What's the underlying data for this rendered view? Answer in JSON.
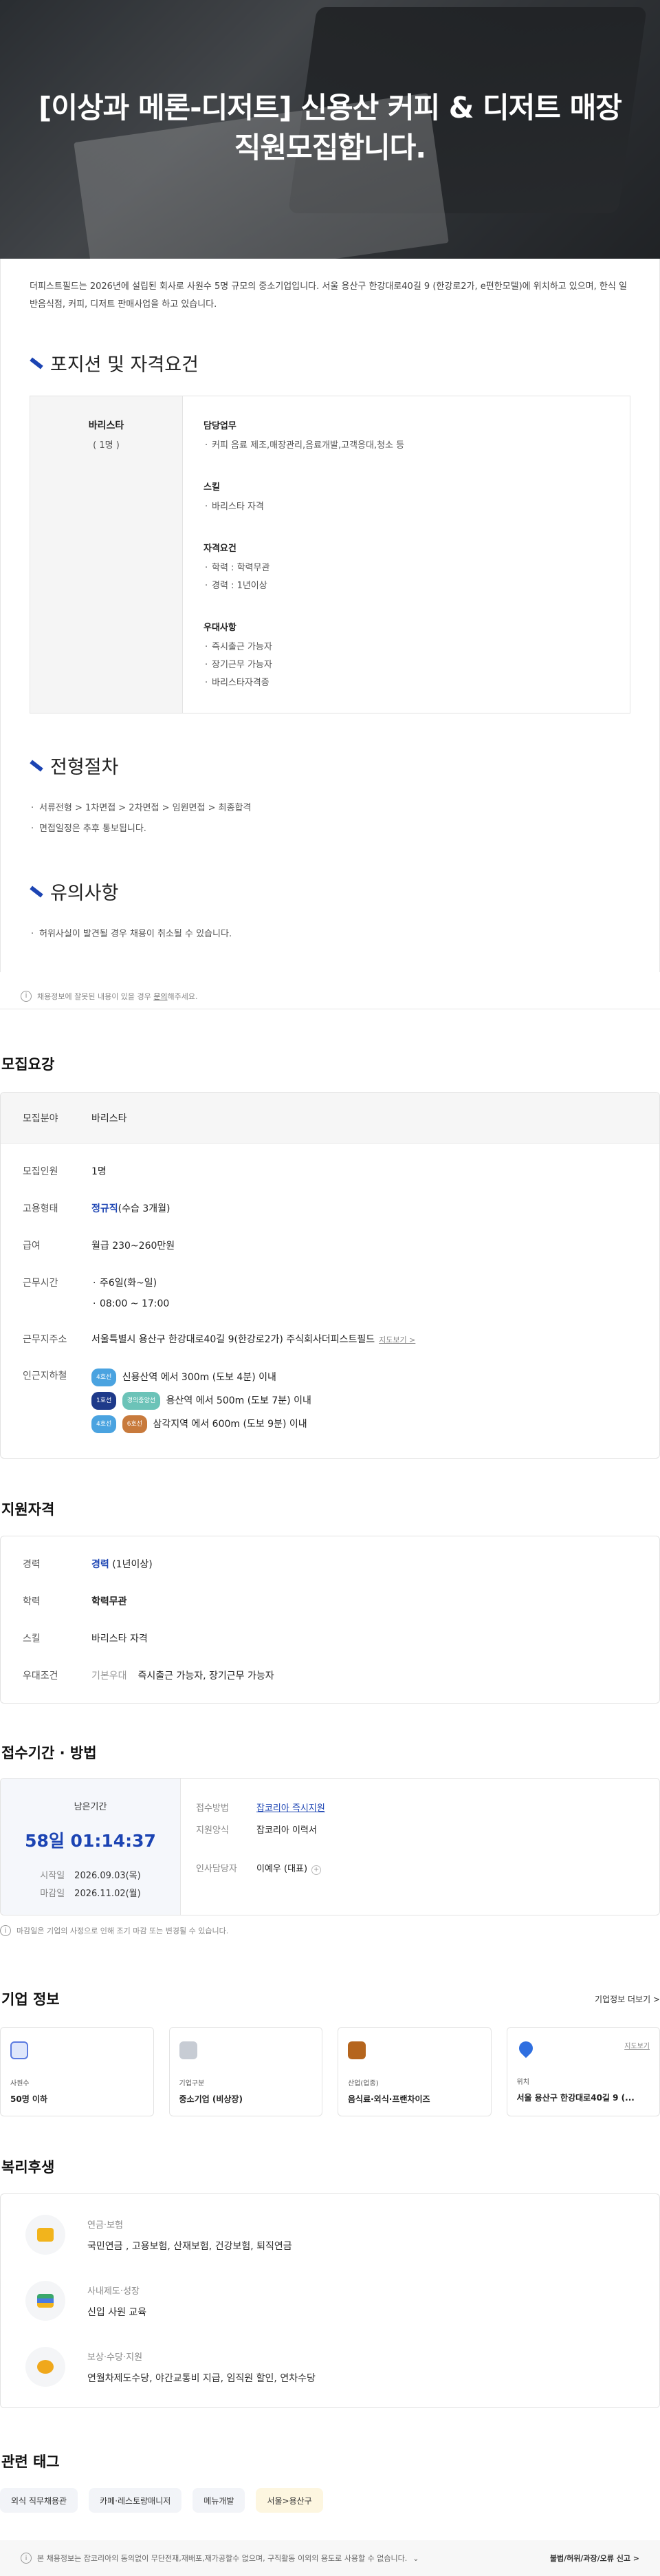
{
  "hero": {
    "title": "[이상과 메론-디저트] 신용산 커피 & 디저트 매장 직원모집합니다."
  },
  "intro": "더피스트필드는 2026년에 설립된 회사로 사원수 5명 규모의 중소기업입니다. 서울 용산구 한강대로40길 9 (한강로2가, e편한모텔)에 위치하고 있으며, 한식 일반음식점, 커피, 디저트 판매사업을 하고 있습니다.",
  "positions": {
    "title": "포지션 및 자격요건",
    "name": "바리스타",
    "count": "( 1명 )",
    "groups": [
      {
        "heading": "담당업무",
        "items": [
          "커피 음료 제조,매장관리,음료개발,고객응대,청소 등"
        ]
      },
      {
        "heading": "스킬",
        "items": [
          "바리스타 자격"
        ]
      },
      {
        "heading": "자격요건",
        "items": [
          "학력 : 학력무관",
          "경력 : 1년이상"
        ]
      },
      {
        "heading": "우대사항",
        "items": [
          "즉시출근 가능자",
          "장기근무 가능자",
          "바리스타자격증"
        ]
      }
    ]
  },
  "process": {
    "title": "전형절차",
    "items": [
      "서류전형 > 1차면접 > 2차면접 > 임원면접 > 최종합격",
      "면접일정은 추후 통보됩니다."
    ]
  },
  "cautions": {
    "title": "유의사항",
    "items": [
      "허위사실이 발견될 경우 채용이 취소될 수 있습니다."
    ]
  },
  "report_notice": {
    "text": "채용정보에 잘못된 내용이 있을 경우",
    "link": "문의",
    "suffix": "해주세요."
  },
  "requirements": {
    "title": "모집요강",
    "field_label": "모집분야",
    "field_value": "바리스타",
    "headcount_label": "모집인원",
    "headcount_value": "1명",
    "type_label": "고용형태",
    "type_value": "정규직",
    "type_note": "(수습 3개월)",
    "salary_label": "급여",
    "salary_value": "월급 230~260만원",
    "hours_label": "근무시간",
    "hours_items": [
      "주6일(화~일)",
      "08:00 ~ 17:00"
    ],
    "address_label": "근무지주소",
    "address_value": "서울특별시 용산구 한강대로40길 9(한강로2가) 주식회사더피스트필드",
    "map_link": "지도보기 >",
    "subway_label": "인근지하철",
    "subways": [
      {
        "badges": [
          {
            "text": "4호선",
            "color": "#4aa3e0"
          }
        ],
        "text": "신용산역 에서 300m (도보 4분) 이내"
      },
      {
        "badges": [
          {
            "text": "1호선",
            "color": "#1e3a8a"
          },
          {
            "text": "경의중앙선",
            "color": "#6cc3b8"
          }
        ],
        "text": "용산역 에서 500m (도보 7분) 이내"
      },
      {
        "badges": [
          {
            "text": "4호선",
            "color": "#4aa3e0"
          },
          {
            "text": "6호선",
            "color": "#c87a3c"
          }
        ],
        "text": "삼각지역 에서 600m (도보 9분) 이내"
      }
    ]
  },
  "eligibility": {
    "title": "지원자격",
    "career_label": "경력",
    "career_value": "경력",
    "career_note": "(1년이상)",
    "edu_label": "학력",
    "edu_value": "학력무관",
    "skill_label": "스킬",
    "skill_value": "바리스타 자격",
    "pref_label": "우대조건",
    "pref_tag": "기본우대",
    "pref_value": "즉시출근 가능자, 장기근무 가능자"
  },
  "period": {
    "title": "접수기간 · 방법",
    "remaining_label": "남은기간",
    "countdown": "58일 01:14:37",
    "start_label": "시작일",
    "start_value": "2026.09.03(목)",
    "end_label": "마감일",
    "end_value": "2026.11.02(월)",
    "method_label": "접수방법",
    "method_value": "잡코리아 즉시지원",
    "form_label": "지원양식",
    "form_value": "잡코리아 이력서",
    "contact_label": "인사담당자",
    "contact_value": "이예우 (대표)",
    "footnote": "마감일은 기업의 사정으로 인해 조기 마감 또는 변경될 수 있습니다."
  },
  "company": {
    "title": "기업 정보",
    "more": "기업정보 더보기 >",
    "cards": [
      {
        "label": "사원수",
        "value": "50명 이하",
        "icon": "people-icon",
        "color": "#5b7be0"
      },
      {
        "label": "기업구분",
        "value": "중소기업 (비상장)",
        "icon": "building-icon",
        "color": "#8a97a8"
      },
      {
        "label": "산업(업종)",
        "value": "음식료·외식·프랜차이즈",
        "icon": "briefcase-icon",
        "color": "#b5651d"
      },
      {
        "label": "위치",
        "value": "서울 용산구 한강대로40길 9 (...",
        "icon": "location-pin-icon",
        "color": "#2f6fe0",
        "map": "지도보기"
      }
    ]
  },
  "welfare": {
    "title": "복리후생",
    "items": [
      {
        "label": "연금·보험",
        "value": "국민연금 , 고용보험, 산재보험, 건강보험, 퇴직연금",
        "icon": "pension-icon",
        "color": "#f2b41c"
      },
      {
        "label": "사내제도·성장",
        "value": "신입 사원 교육",
        "icon": "growth-icon",
        "color": "#3aa86b"
      },
      {
        "label": "보상·수당·지원",
        "value": "연월차제도수당, 야간교통비 지급, 임직원 할인, 연차수당",
        "icon": "money-bag-icon",
        "color": "#f0a81c"
      }
    ]
  },
  "tags": {
    "title": "관련 태그",
    "items": [
      "외식 직무채용관",
      "카페·레스토랑매니저",
      "메뉴개발",
      "서울>용산구"
    ]
  },
  "footer": {
    "notice": "본 채용정보는 잡코리아의 동의없이 무단전재,재배포,재가공할수 없으며, 구직활동 이외의 용도로 사용할 수 없습니다.",
    "report": "불법/허위/과장/오류 신고 >"
  }
}
